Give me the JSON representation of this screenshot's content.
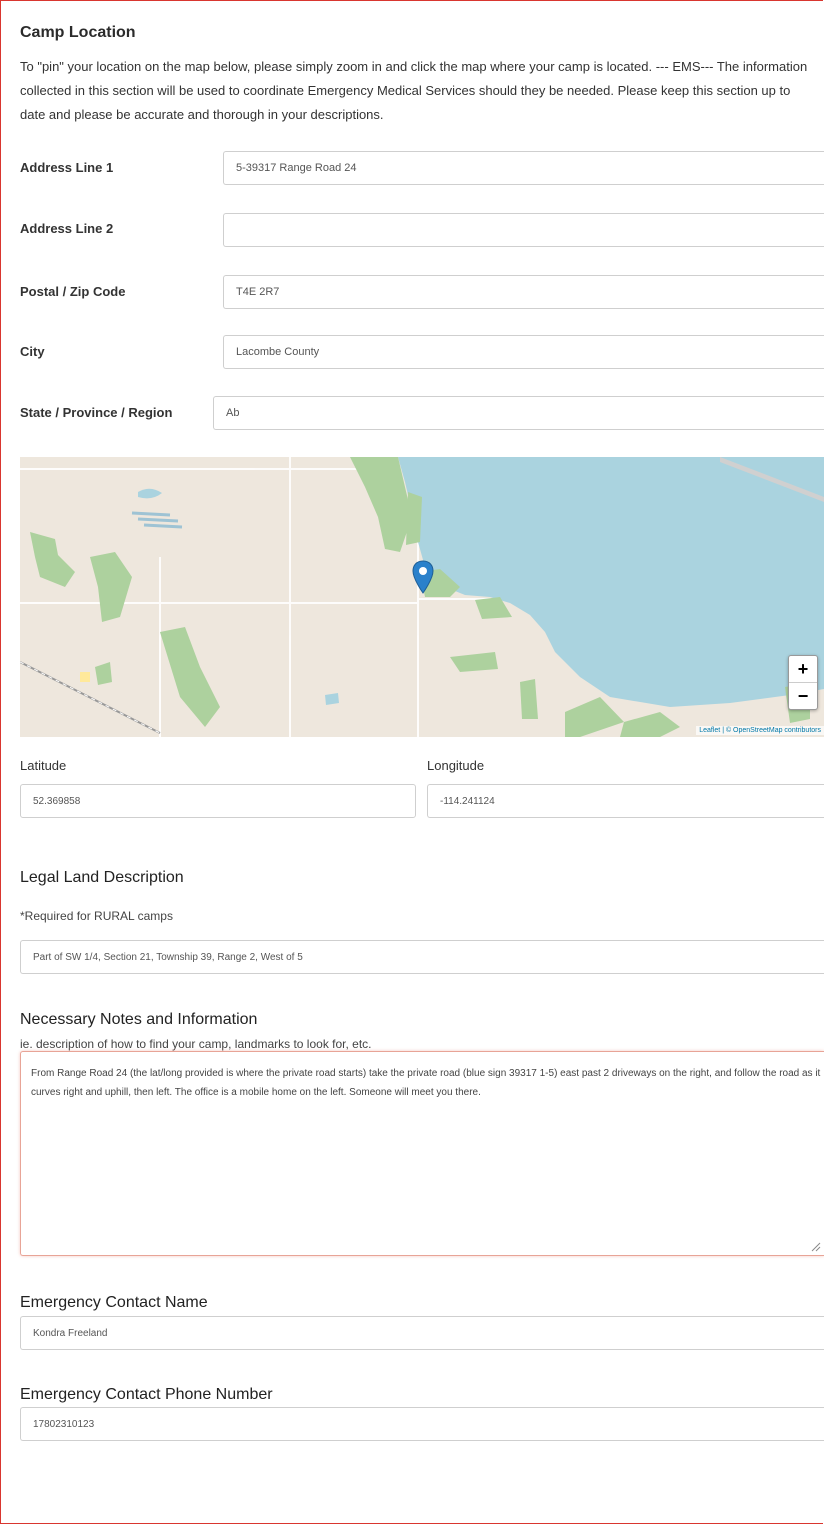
{
  "camp_location": {
    "title": "Camp Location",
    "intro": "To \"pin\" your location on the map below, please simply zoom in and click the map where your camp is located. --- EMS--- The information collected in this section will be used to coordinate Emergency Medical Services should they be needed. Please keep this section up to date and please be accurate and thorough in your descriptions."
  },
  "address": {
    "line1_label": "Address Line 1",
    "line1_value": "5-39317 Range Road 24",
    "line2_label": "Address Line 2",
    "line2_value": "",
    "postal_label": "Postal / Zip Code",
    "postal_value": "T4E 2R7",
    "city_label": "City",
    "city_value": "Lacombe County",
    "state_label": "State / Province / Region",
    "state_value": "Ab"
  },
  "map": {
    "zoom_in": "+",
    "zoom_out": "−",
    "attribution": "Leaflet | © OpenStreetMap contributors",
    "water_color": "#aad3df",
    "land_color": "#eee7dd",
    "park_color": "#add19e",
    "marker_color": "#2a81cb"
  },
  "coords": {
    "latitude_label": "Latitude",
    "latitude_value": "52.369858",
    "longitude_label": "Longitude",
    "longitude_value": "-114.241124"
  },
  "legal": {
    "title": "Legal Land Description",
    "note": "*Required for RURAL camps",
    "value": "Part of SW 1/4, Section 21, Township 39, Range 2, West of 5"
  },
  "notes": {
    "title": "Necessary Notes and Information",
    "hint": "ie. description of how to find your camp, landmarks to look for, etc.",
    "value": "From Range Road 24 (the lat/long provided is where the private road starts) take the private road (blue sign 39317 1-5) east past 2 driveways on the right, and follow the road as it curves right and uphill, then left. The office is a mobile home on the left. Someone will meet you there."
  },
  "emergency": {
    "name_title": "Emergency Contact Name",
    "name_value": "Kondra Freeland",
    "phone_title": "Emergency Contact Phone Number",
    "phone_value": "17802310123"
  }
}
